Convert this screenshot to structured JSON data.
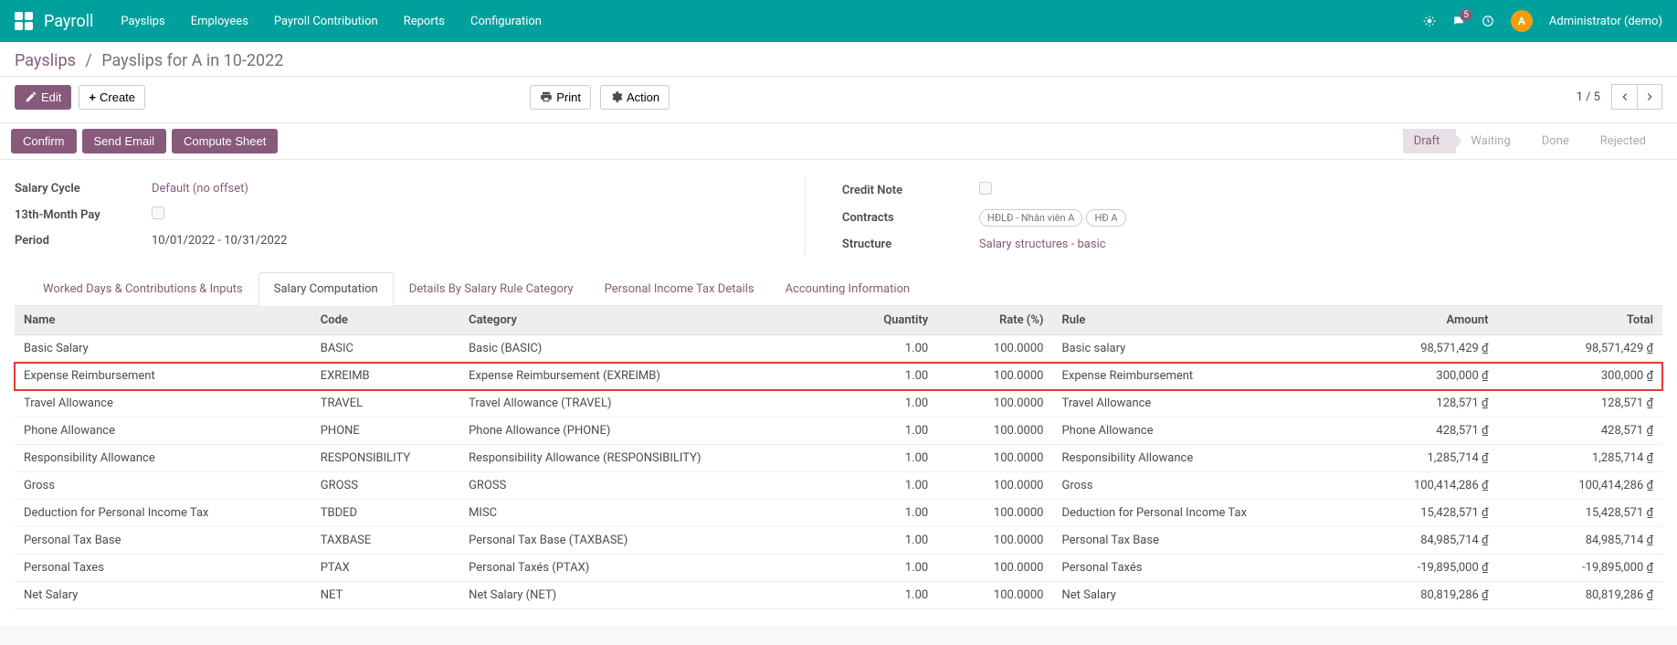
{
  "topbar": {
    "app_title": "Payroll",
    "menu": [
      "Payslips",
      "Employees",
      "Payroll Contribution",
      "Reports",
      "Configuration"
    ],
    "message_count": "5",
    "user_initial": "A",
    "user_name": "Administrator (demo)"
  },
  "breadcrumb": {
    "parent": "Payslips",
    "current": "Payslips for A in 10-2022"
  },
  "buttons": {
    "edit": "Edit",
    "create": "Create",
    "print": "Print",
    "action": "Action",
    "confirm": "Confirm",
    "send_email": "Send Email",
    "compute": "Compute Sheet"
  },
  "pager": {
    "pos": "1 / 5"
  },
  "stages": [
    "Draft",
    "Waiting",
    "Done",
    "Rejected"
  ],
  "active_stage": 0,
  "form": {
    "salary_cycle_label": "Salary Cycle",
    "salary_cycle_value": "Default (no offset)",
    "thirteenth_label": "13th-Month Pay",
    "period_label": "Period",
    "period_value": "10/01/2022 - 10/31/2022",
    "credit_note_label": "Credit Note",
    "contracts_label": "Contracts",
    "contracts_tags": [
      "HĐLĐ - Nhân viên A",
      "HĐ A"
    ],
    "structure_label": "Structure",
    "structure_value": "Salary structures - basic"
  },
  "tabs": [
    "Worked Days & Contributions & Inputs",
    "Salary Computation",
    "Details By Salary Rule Category",
    "Personal Income Tax Details",
    "Accounting Information"
  ],
  "active_tab": 1,
  "table": {
    "headers": {
      "name": "Name",
      "code": "Code",
      "category": "Category",
      "quantity": "Quantity",
      "rate": "Rate (%)",
      "rule": "Rule",
      "amount": "Amount",
      "total": "Total"
    },
    "rows": [
      {
        "name": "Basic Salary",
        "code": "BASIC",
        "category": "Basic (BASIC)",
        "quantity": "1.00",
        "rate": "100.0000",
        "rule": "Basic salary",
        "amount": "98,571,429 ₫",
        "total": "98,571,429 ₫",
        "highlight": false
      },
      {
        "name": "Expense Reimbursement",
        "code": "EXREIMB",
        "category": "Expense Reimbursement (EXREIMB)",
        "quantity": "1.00",
        "rate": "100.0000",
        "rule": "Expense Reimbursement",
        "amount": "300,000 ₫",
        "total": "300,000 ₫",
        "highlight": true
      },
      {
        "name": "Travel Allowance",
        "code": "TRAVEL",
        "category": "Travel Allowance (TRAVEL)",
        "quantity": "1.00",
        "rate": "100.0000",
        "rule": "Travel Allowance",
        "amount": "128,571 ₫",
        "total": "128,571 ₫",
        "highlight": false
      },
      {
        "name": "Phone Allowance",
        "code": "PHONE",
        "category": "Phone Allowance (PHONE)",
        "quantity": "1.00",
        "rate": "100.0000",
        "rule": "Phone Allowance",
        "amount": "428,571 ₫",
        "total": "428,571 ₫",
        "highlight": false
      },
      {
        "name": "Responsibility Allowance",
        "code": "RESPONSIBILITY",
        "category": "Responsibility Allowance (RESPONSIBILITY)",
        "quantity": "1.00",
        "rate": "100.0000",
        "rule": "Responsibility Allowance",
        "amount": "1,285,714 ₫",
        "total": "1,285,714 ₫",
        "highlight": false
      },
      {
        "name": "Gross",
        "code": "GROSS",
        "category": "GROSS",
        "quantity": "1.00",
        "rate": "100.0000",
        "rule": "Gross",
        "amount": "100,414,286 ₫",
        "total": "100,414,286 ₫",
        "highlight": false
      },
      {
        "name": "Deduction for Personal Income Tax",
        "code": "TBDED",
        "category": "MISC",
        "quantity": "1.00",
        "rate": "100.0000",
        "rule": "Deduction for Personal Income Tax",
        "amount": "15,428,571 ₫",
        "total": "15,428,571 ₫",
        "highlight": false
      },
      {
        "name": "Personal Tax Base",
        "code": "TAXBASE",
        "category": "Personal Tax Base (TAXBASE)",
        "quantity": "1.00",
        "rate": "100.0000",
        "rule": "Personal Tax Base",
        "amount": "84,985,714 ₫",
        "total": "84,985,714 ₫",
        "highlight": false
      },
      {
        "name": "Personal Taxes",
        "code": "PTAX",
        "category": "Personal Taxés (PTAX)",
        "quantity": "1.00",
        "rate": "100.0000",
        "rule": "Personal Taxés",
        "amount": "-19,895,000 ₫",
        "total": "-19,895,000 ₫",
        "highlight": false
      },
      {
        "name": "Net Salary",
        "code": "NET",
        "category": "Net Salary (NET)",
        "quantity": "1.00",
        "rate": "100.0000",
        "rule": "Net Salary",
        "amount": "80,819,286 ₫",
        "total": "80,819,286 ₫",
        "highlight": false
      }
    ]
  }
}
